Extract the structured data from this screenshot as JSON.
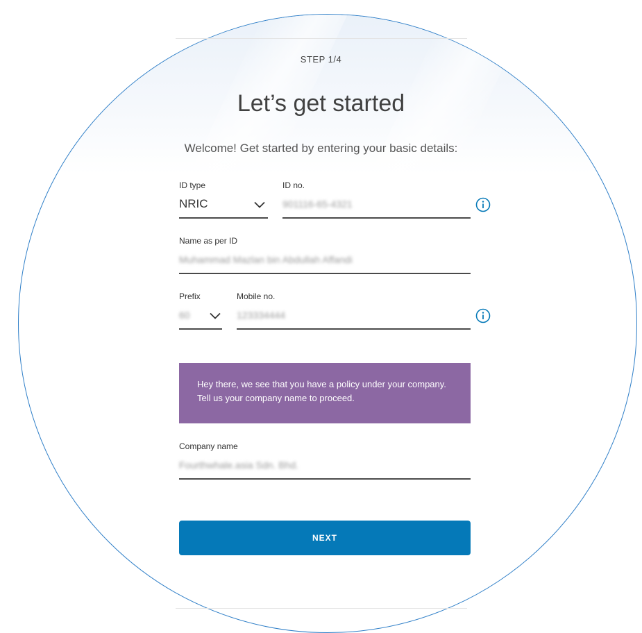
{
  "header": {
    "step": "STEP 1/4",
    "title": "Let’s get started",
    "subtitle": "Welcome! Get started by entering your basic details:"
  },
  "form": {
    "id_type": {
      "label": "ID type",
      "value": "NRIC",
      "icon": "chevron-down-icon"
    },
    "id_no": {
      "label": "ID no.",
      "value": "901116-65-4321",
      "icon": "info-icon"
    },
    "name": {
      "label": "Name as per ID",
      "value": "Muhammad Mazlan bin Abdullah Affandi"
    },
    "prefix": {
      "label": "Prefix",
      "value": "60",
      "icon": "chevron-down-icon"
    },
    "mobile": {
      "label": "Mobile no.",
      "value": "123334444",
      "icon": "info-icon"
    },
    "notice": "Hey there, we see that you have a policy under your company. Tell us your company name to proceed.",
    "company": {
      "label": "Company name",
      "value": "Fourthwhale.asia Sdn. Bhd."
    }
  },
  "actions": {
    "next_label": "NEXT"
  },
  "colors": {
    "accent": "#0579b8",
    "notice_bg": "#8c68a3",
    "frame": "#2f7fc8"
  }
}
